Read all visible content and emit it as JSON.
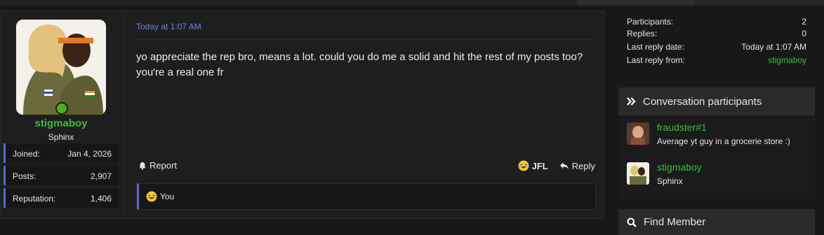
{
  "message": {
    "user": {
      "username": "stigmaboy",
      "title": "Sphinx",
      "stats": [
        {
          "label": "Joined:",
          "value": "Jan 4, 2026"
        },
        {
          "label": "Posts:",
          "value": "2,907"
        },
        {
          "label": "Reputation:",
          "value": "1,406"
        }
      ]
    },
    "timestamp": "Today at 1:07 AM",
    "body": "yo appreciate the rep bro, means a lot. could you do me a solid and hit the rest of my posts too? you're a real one fr",
    "actions": {
      "report": "Report",
      "reaction": "JFL",
      "reply": "Reply"
    },
    "reactions_line": "You"
  },
  "sidebar": {
    "info": [
      {
        "label": "Participants:",
        "value": "2"
      },
      {
        "label": "Replies:",
        "value": "0"
      },
      {
        "label": "Last reply date:",
        "value": "Today at 1:07 AM"
      },
      {
        "label": "Last reply from:",
        "value": "stigmaboy"
      }
    ],
    "participants_title": "Conversation participants",
    "participants": [
      {
        "name": "fraudster#1",
        "subtitle": "Average yt guy in a grocerie store :)"
      },
      {
        "name": "stigmaboy",
        "subtitle": "Sphinx"
      }
    ],
    "find_member_title": "Find Member"
  },
  "colors": {
    "accent": "#5a6bd0",
    "username_green": "#3dbb3d",
    "time_blue": "#6d7fe0"
  }
}
